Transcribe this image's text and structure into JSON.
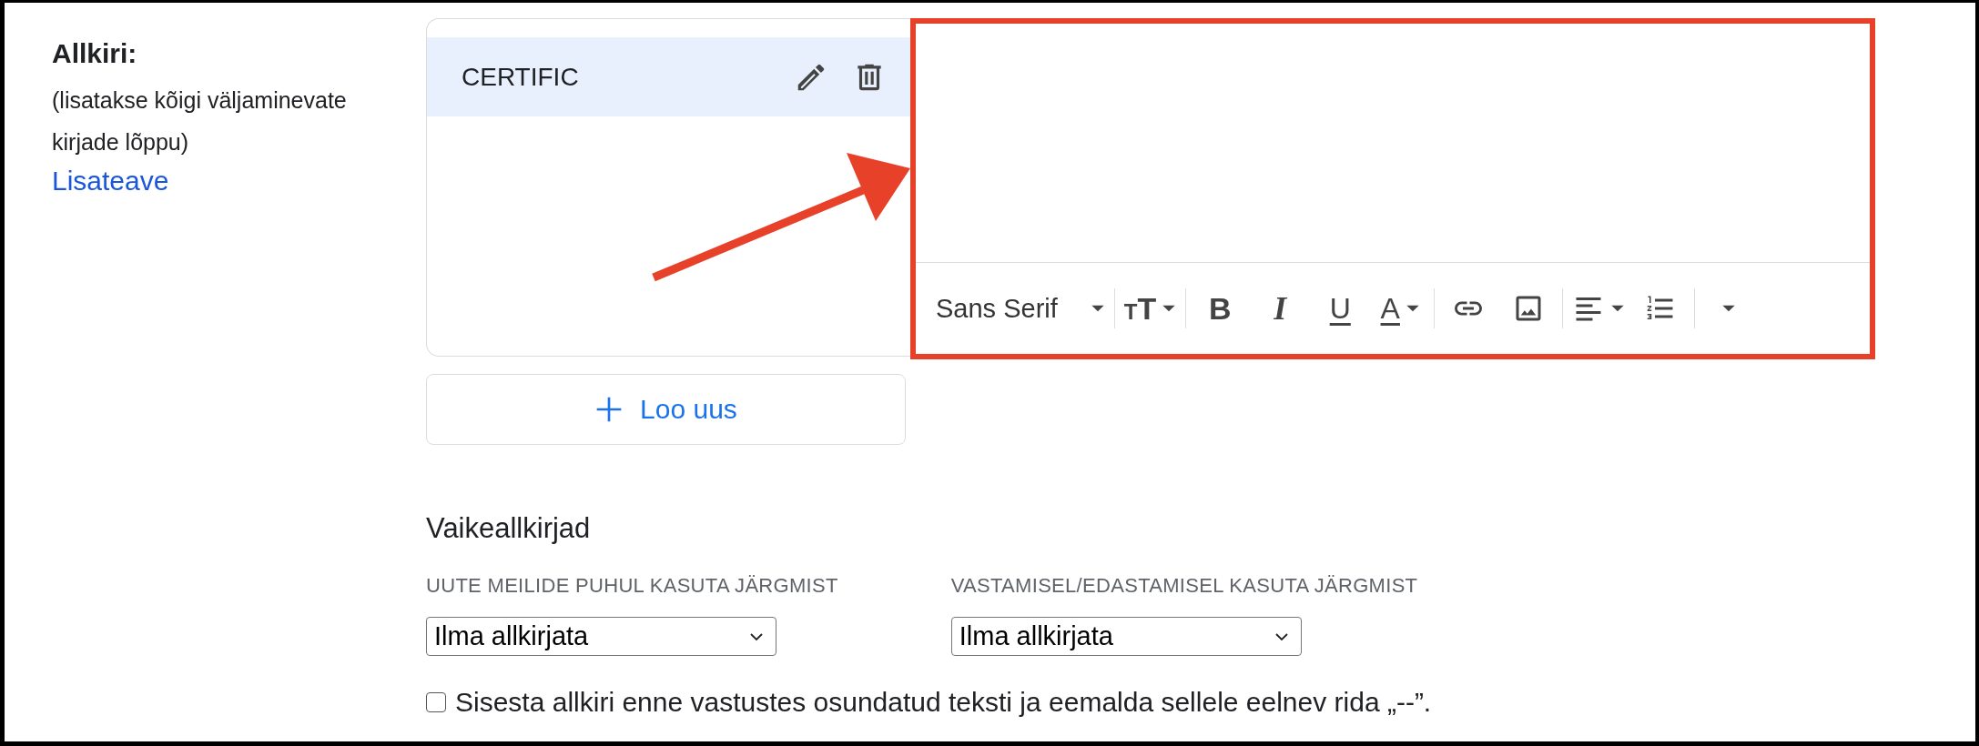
{
  "section": {
    "title": "Allkiri:",
    "description": "(lisatakse kõigi väljaminevate kirjade lõppu)",
    "link": "Lisateave"
  },
  "signatures": [
    {
      "name": "CERTIFIC",
      "selected": true
    }
  ],
  "create_button": {
    "label": "Loo uus"
  },
  "editor": {
    "toolbar_groups": [
      [
        {
          "kind": "font",
          "label": "Sans Serif",
          "caret": true
        }
      ],
      [
        {
          "kind": "text-size",
          "text": "TT",
          "caret": true
        }
      ],
      [
        {
          "kind": "bold",
          "text": "B",
          "caret": false
        },
        {
          "kind": "italic",
          "text": "I",
          "caret": false
        },
        {
          "kind": "underline",
          "text": "U",
          "caret": false
        },
        {
          "kind": "text-color",
          "text": "A",
          "caret": true
        }
      ],
      [
        {
          "kind": "link",
          "caret": false
        },
        {
          "kind": "image",
          "caret": false
        }
      ],
      [
        {
          "kind": "align",
          "caret": true
        },
        {
          "kind": "numbered-list",
          "caret": false
        }
      ],
      [
        {
          "kind": "more",
          "caret": true
        }
      ]
    ]
  },
  "defaults": {
    "title": "Vaikeallkirjad",
    "selects": [
      {
        "label": "UUTE MEILIDE PUHUL KASUTA JÄRGMIST",
        "value": "Ilma allkirjata"
      },
      {
        "label": "VASTAMISEL/EDASTAMISEL KASUTA JÄRGMIST",
        "value": "Ilma allkirjata"
      }
    ],
    "option": {
      "label": "Sisesta allkiri enne vastustes osundatud teksti ja eemalda sellele eelnev rida „--”.",
      "checked": false
    }
  }
}
